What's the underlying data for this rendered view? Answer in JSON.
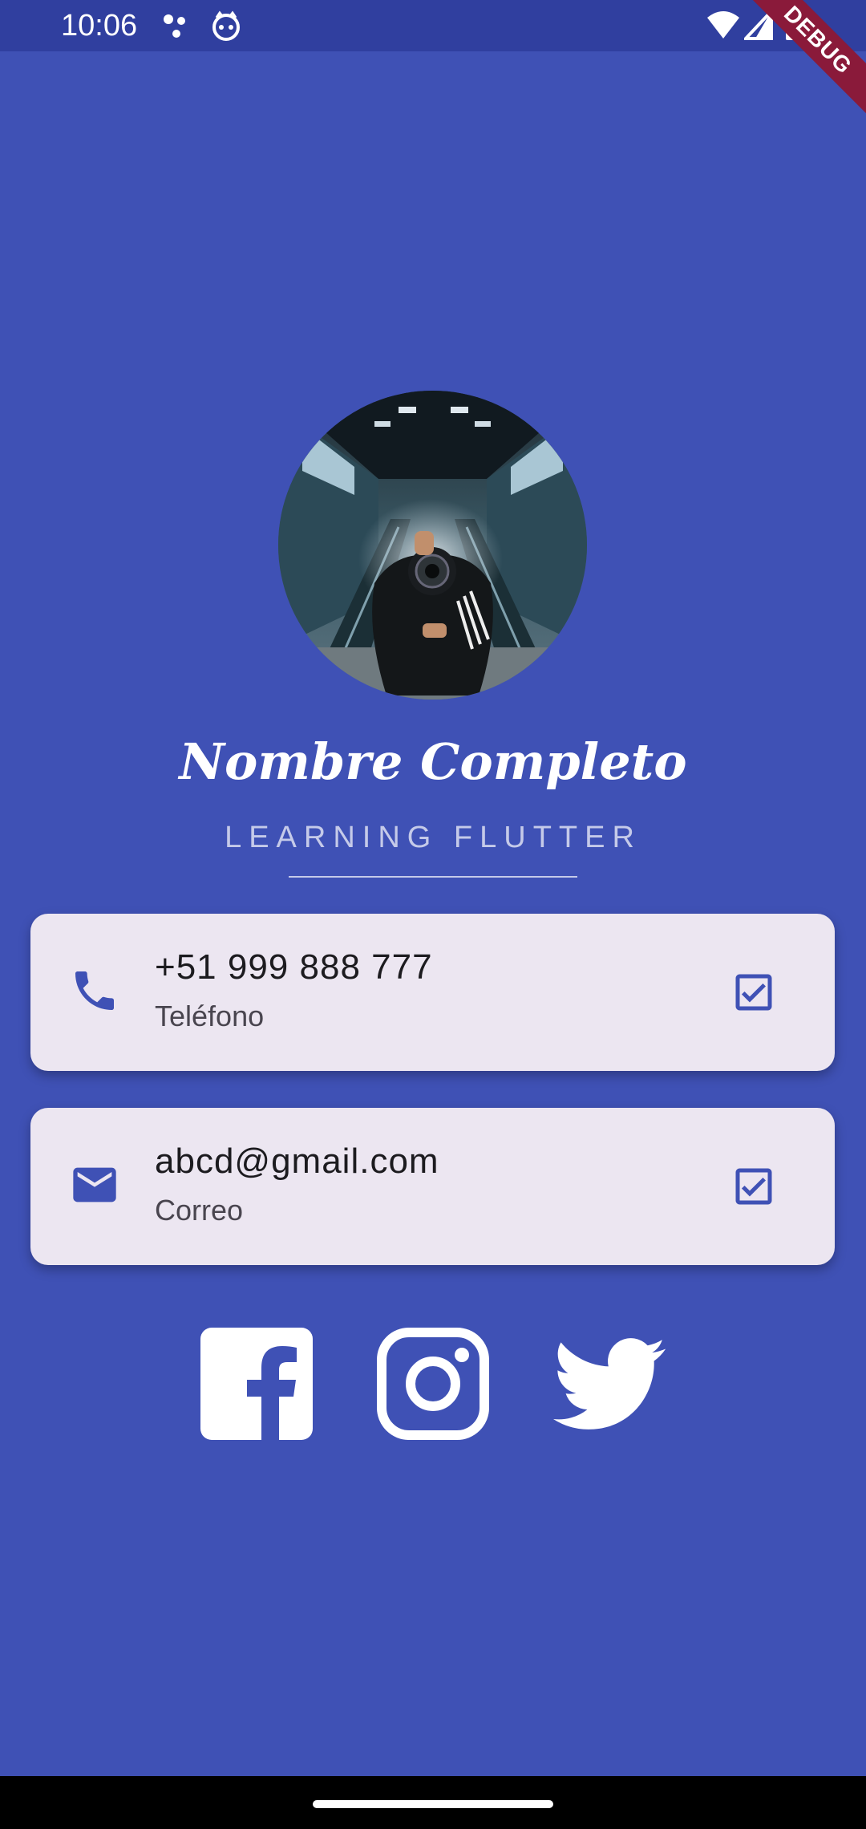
{
  "status_bar": {
    "time": "10:06",
    "icons": [
      "notification-dots-icon",
      "cat-face-icon",
      "wifi-icon",
      "signal-icon",
      "battery-icon"
    ],
    "debug_label": "DEBUG"
  },
  "profile": {
    "name": "Nombre Completo",
    "subtitle": "LEARNING FLUTTER"
  },
  "cards": [
    {
      "value": "+51 999 888 777",
      "label": "Teléfono",
      "icon": "phone-icon",
      "checked": true
    },
    {
      "value": "abcd@gmail.com",
      "label": "Correo",
      "icon": "email-icon",
      "checked": true
    }
  ],
  "social": [
    "facebook-icon",
    "instagram-icon",
    "twitter-icon"
  ],
  "colors": {
    "background": "#3f51b5",
    "status_bar": "#303f9f",
    "card": "#ece6f1",
    "accent": "#3f51b5",
    "debug_banner": "#8a1a3a"
  }
}
